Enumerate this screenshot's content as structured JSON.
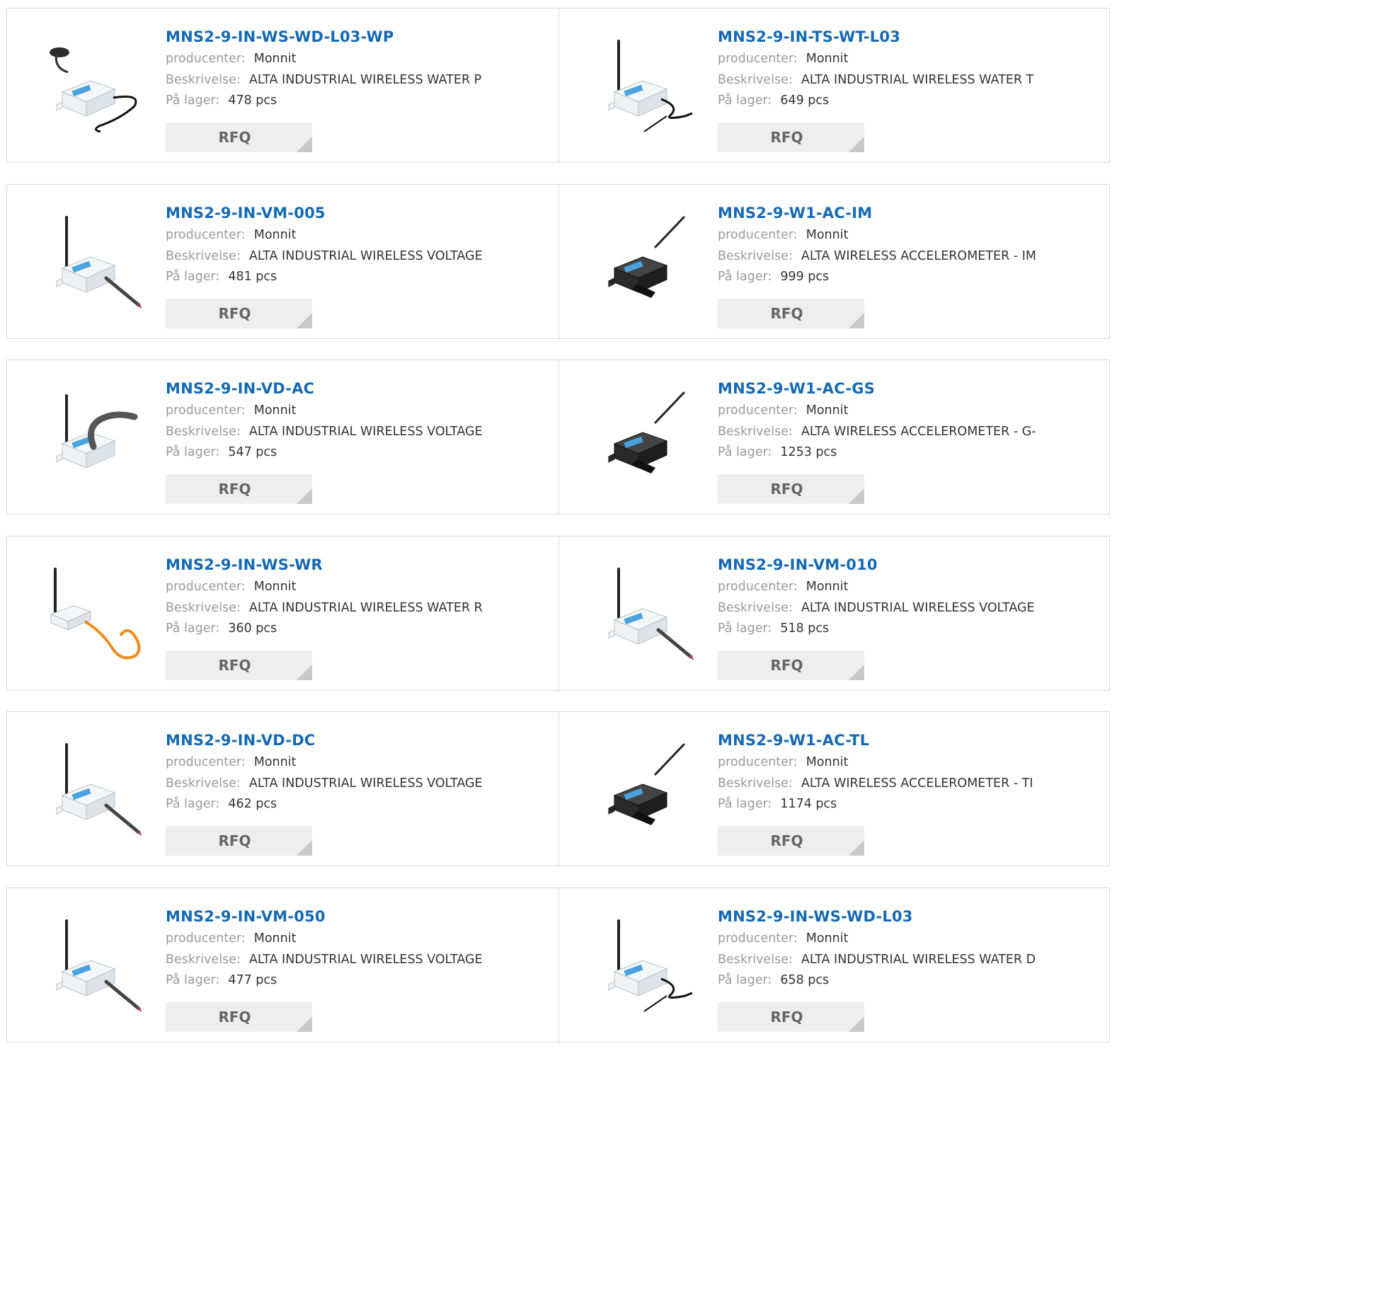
{
  "labels": {
    "manufacturer": "producenter:",
    "description": "Beskrivelse:",
    "stock": "På lager:",
    "rfq": "RFQ"
  },
  "rows": [
    [
      {
        "part": "MNS2-9-IN-WS-WD-L03-WP",
        "manufacturer": "Monnit",
        "description": "ALTA INDUSTRIAL WIRELESS WATER P",
        "stock": "478 pcs",
        "image": "water-puck-sensor"
      },
      {
        "part": "MNS2-9-IN-TS-WT-L03",
        "manufacturer": "Monnit",
        "description": "ALTA INDUSTRIAL WIRELESS WATER T",
        "stock": "649 pcs",
        "image": "antenna-sensor-probe"
      }
    ],
    [
      {
        "part": "MNS2-9-IN-VM-005",
        "manufacturer": "Monnit",
        "description": "ALTA INDUSTRIAL WIRELESS VOLTAGE",
        "stock": "481 pcs",
        "image": "antenna-sensor-cable"
      },
      {
        "part": "MNS2-9-W1-AC-IM",
        "manufacturer": "Monnit",
        "description": "ALTA WIRELESS ACCELEROMETER - IM",
        "stock": "999 pcs",
        "image": "black-accelerometer"
      }
    ],
    [
      {
        "part": "MNS2-9-IN-VD-AC",
        "manufacturer": "Monnit",
        "description": "ALTA INDUSTRIAL WIRELESS VOLTAGE",
        "stock": "547 pcs",
        "image": "antenna-sensor-conduit"
      },
      {
        "part": "MNS2-9-W1-AC-GS",
        "manufacturer": "Monnit",
        "description": "ALTA WIRELESS ACCELEROMETER - G-",
        "stock": "1253 pcs",
        "image": "black-accelerometer"
      }
    ],
    [
      {
        "part": "MNS2-9-IN-WS-WR",
        "manufacturer": "Monnit",
        "description": "ALTA INDUSTRIAL WIRELESS WATER R",
        "stock": "360 pcs",
        "image": "antenna-sensor-orange-rope"
      },
      {
        "part": "MNS2-9-IN-VM-010",
        "manufacturer": "Monnit",
        "description": "ALTA INDUSTRIAL WIRELESS VOLTAGE",
        "stock": "518 pcs",
        "image": "antenna-sensor-cable"
      }
    ],
    [
      {
        "part": "MNS2-9-IN-VD-DC",
        "manufacturer": "Monnit",
        "description": "ALTA INDUSTRIAL WIRELESS VOLTAGE",
        "stock": "462 pcs",
        "image": "antenna-sensor-cable"
      },
      {
        "part": "MNS2-9-W1-AC-TL",
        "manufacturer": "Monnit",
        "description": "ALTA WIRELESS ACCELEROMETER - TI",
        "stock": "1174 pcs",
        "image": "black-accelerometer"
      }
    ],
    [
      {
        "part": "MNS2-9-IN-VM-050",
        "manufacturer": "Monnit",
        "description": "ALTA INDUSTRIAL WIRELESS VOLTAGE",
        "stock": "477 pcs",
        "image": "antenna-sensor-cable"
      },
      {
        "part": "MNS2-9-IN-WS-WD-L03",
        "manufacturer": "Monnit",
        "description": "ALTA INDUSTRIAL WIRELESS WATER D",
        "stock": "658 pcs",
        "image": "antenna-sensor-probe"
      }
    ]
  ],
  "colors": {
    "title": "#1469b4",
    "label": "#9a9a9a",
    "button_bg": "#eeeeee",
    "border": "#d9d9d9"
  }
}
